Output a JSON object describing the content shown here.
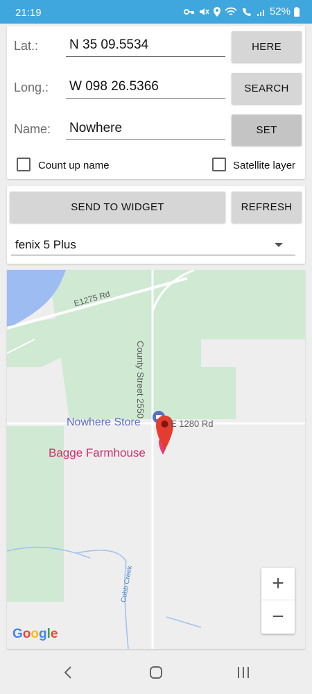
{
  "status_bar": {
    "time": "21:19",
    "battery": "52%"
  },
  "form": {
    "lat_label": "Lat.:",
    "lat_value": "N 35 09.5534",
    "long_label": "Long.:",
    "long_value": "W 098 26.5366",
    "name_label": "Name:",
    "name_value": "Nowhere",
    "here_button": "HERE",
    "search_button": "SEARCH",
    "set_button": "SET",
    "count_up_label": "Count up name",
    "count_up_checked": false,
    "satellite_label": "Satellite layer",
    "satellite_checked": false
  },
  "widget": {
    "send_button": "SEND TO WIDGET",
    "refresh_button": "REFRESH",
    "device": "fenix 5 Plus"
  },
  "map": {
    "poi_store": "Nowhere Store",
    "poi_farm": "Bagge Farmhouse",
    "road_e1280": "E 1280 Rd",
    "road_e1275": "E1275 Rd",
    "road_county": "County Street 2550",
    "creek": "Cobb Creek",
    "attribution": "Google",
    "zoom_in": "+",
    "zoom_out": "−",
    "colors": {
      "forest": "#cfe9d3",
      "water": "#9dbcf2",
      "marker": "#e43d30",
      "store": "#5b6ec5",
      "farm": "#d0306d"
    }
  },
  "icons": [
    "vpn-key-icon",
    "mute-icon",
    "location-icon",
    "wifi-icon",
    "wifi-call-icon",
    "signal-icon",
    "battery-icon",
    "back-icon",
    "home-icon",
    "recents-icon",
    "map-pin-icon",
    "store-icon",
    "restaurant-icon"
  ]
}
